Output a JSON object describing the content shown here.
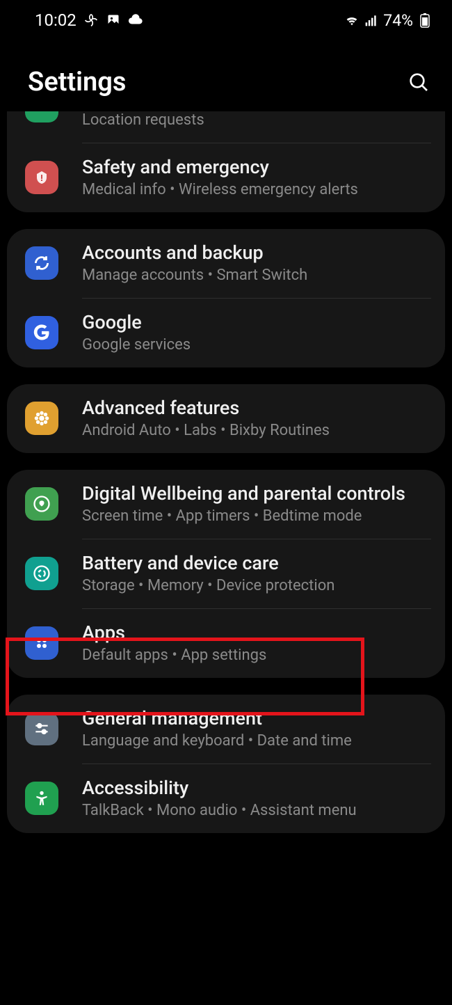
{
  "statusbar": {
    "time": "10:02",
    "battery": "74%"
  },
  "header": {
    "title": "Settings"
  },
  "groups": [
    {
      "partial": true,
      "items": [
        {
          "title_visible": false,
          "subtitle": "Location requests",
          "icon": "location",
          "icon_bg": "#20a060"
        },
        {
          "title": "Safety and emergency",
          "subtitle": "Medical info  •  Wireless emergency alerts",
          "icon": "emergency",
          "icon_bg": "#d05050"
        }
      ]
    },
    {
      "items": [
        {
          "title": "Accounts and backup",
          "subtitle": "Manage accounts  •  Smart Switch",
          "icon": "sync",
          "icon_bg": "#3060d0"
        },
        {
          "title": "Google",
          "subtitle": "Google services",
          "icon": "google",
          "icon_bg": "#3060e0"
        }
      ]
    },
    {
      "items": [
        {
          "title": "Advanced features",
          "subtitle": "Android Auto  •  Labs  •  Bixby Routines",
          "icon": "gear-flower",
          "icon_bg": "#e0a030"
        }
      ]
    },
    {
      "items": [
        {
          "title": "Digital Wellbeing and parental controls",
          "subtitle": "Screen time  •  App timers  •  Bedtime mode",
          "icon": "wellbeing",
          "icon_bg": "#40a050"
        },
        {
          "title": "Battery and device care",
          "subtitle": "Storage  •  Memory  •  Device protection",
          "icon": "device-care",
          "icon_bg": "#10a090",
          "highlighted": true
        },
        {
          "title": "Apps",
          "subtitle": "Default apps  •  App settings",
          "icon": "apps",
          "icon_bg": "#3060d0"
        }
      ]
    },
    {
      "items": [
        {
          "title": "General management",
          "subtitle": "Language and keyboard  •  Date and time",
          "icon": "sliders",
          "icon_bg": "#607080"
        },
        {
          "title": "Accessibility",
          "subtitle": "TalkBack  •  Mono audio  •  Assistant menu",
          "icon": "accessibility",
          "icon_bg": "#20a050"
        }
      ]
    }
  ]
}
